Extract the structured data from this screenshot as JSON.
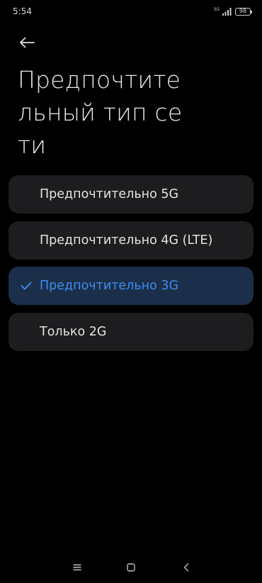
{
  "status_bar": {
    "time": "5:54",
    "network_type": "3G",
    "battery_level": "98",
    "icons": [
      "signal-icon",
      "battery-icon"
    ]
  },
  "header": {
    "back_icon": "arrow-left-icon",
    "title": "Предпочтительный тип сети"
  },
  "options": [
    {
      "label": "Предпочтительно 5G",
      "selected": false
    },
    {
      "label": "Предпочтительно 4G (LTE)",
      "selected": false
    },
    {
      "label": "Предпочтительно 3G",
      "selected": true
    },
    {
      "label": "Только 2G",
      "selected": false
    }
  ],
  "nav_bar": {
    "icons": [
      "menu-icon",
      "home-icon",
      "back-icon"
    ]
  },
  "colors": {
    "background": "#000000",
    "card": "#1d1d1f",
    "selected_card": "#1c2f4a",
    "accent": "#3c8cf0",
    "text": "#e4e4e4"
  }
}
